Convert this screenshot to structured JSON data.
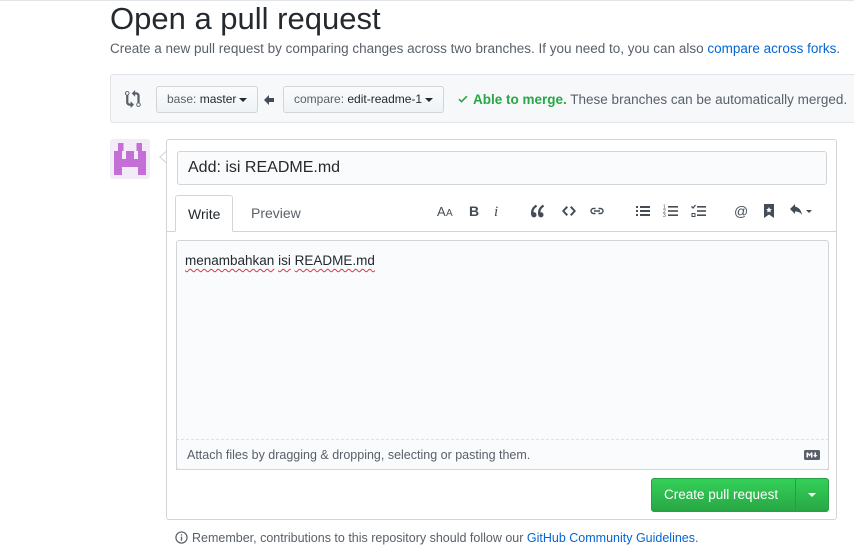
{
  "header": {
    "title": "Open a pull request",
    "subtitle_prefix": "Create a new pull request by comparing changes across two branches. If you need to, you can also ",
    "compare_forks_link": "compare across forks",
    "subtitle_suffix": "."
  },
  "range": {
    "base_prefix": "base:",
    "base_branch": "master",
    "compare_prefix": "compare:",
    "compare_branch": "edit-readme-1",
    "merge_ok": "Able to merge.",
    "merge_detail": " These branches can be automatically merged."
  },
  "form": {
    "title_value": "Add: isi README.md",
    "tab_write": "Write",
    "tab_preview": "Preview",
    "body_word1": "menambahkan",
    "body_word2": "isi",
    "body_word3": "README.md",
    "attach_text": "Attach files by dragging & dropping, selecting or pasting them.",
    "submit_label": "Create pull request"
  },
  "toolbar_icons": [
    "text-size-icon",
    "bold-icon",
    "italic-icon",
    "quote-icon",
    "code-icon",
    "link-icon",
    "bulleted-list-icon",
    "numbered-list-icon",
    "task-list-icon",
    "mention-icon",
    "reference-icon",
    "reply-icon"
  ],
  "footer": {
    "note_prefix": "Remember, contributions to this repository should follow our ",
    "guidelines_link": "GitHub Community Guidelines",
    "note_suffix": "."
  },
  "colors": {
    "accent": "#0366d6",
    "success": "#28a745",
    "avatar": "#c46fd5"
  }
}
